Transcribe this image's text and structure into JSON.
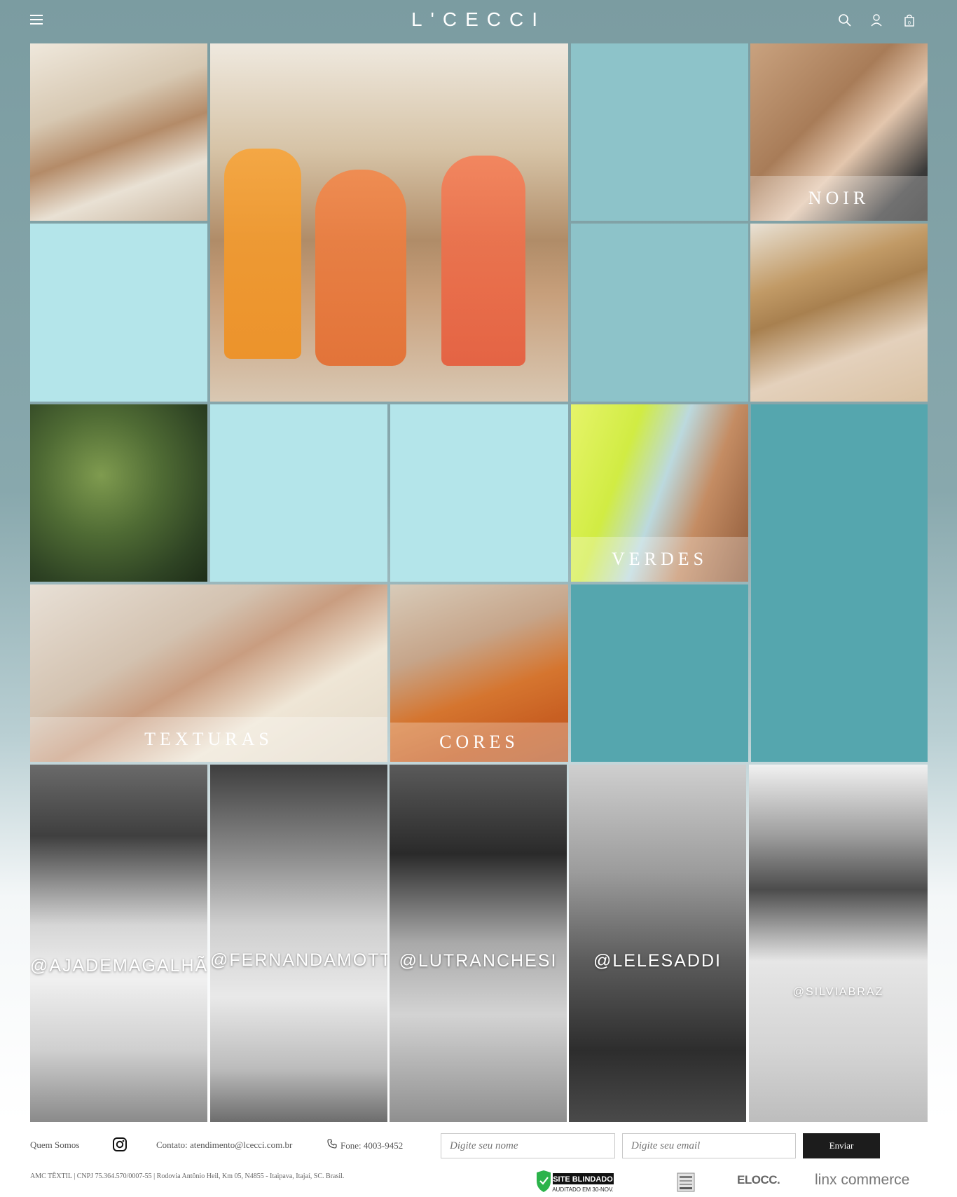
{
  "header": {
    "logo": "L'CECCI",
    "icons": [
      "menu-icon",
      "search-icon",
      "user-icon",
      "bag-icon"
    ],
    "bag_count": "0"
  },
  "grid": {
    "tiles": [
      {
        "caption": ""
      },
      {
        "caption": ""
      },
      {
        "caption": "NOIR"
      },
      {
        "caption": ""
      },
      {
        "caption": ""
      },
      {
        "caption": "VERDES"
      },
      {
        "caption": "TEXTURAS"
      },
      {
        "caption": "CORES"
      }
    ],
    "colors": {
      "light_blue": "#b4e5ea",
      "mid_blue": "#8dc3c9",
      "teal": "#55a6ae"
    }
  },
  "influencers": [
    {
      "handle": "@AJADEMAGALHÃES"
    },
    {
      "handle": "@FERNANDAMOTTA"
    },
    {
      "handle": "@LUTRANCHESI"
    },
    {
      "handle": "@LELESADDI"
    },
    {
      "handle": "@SILVIABRAZ"
    }
  ],
  "footer": {
    "about": "Quem Somos",
    "contact": "Contato: atendimento@lcecci.com.br",
    "phone": "Fone: 4003-9452",
    "name_placeholder": "Digite seu nome",
    "email_placeholder": "Digite seu email",
    "send": "Enviar",
    "legal": "AMC TÊXTIL | CNPJ 75.364.570/0007-55 | Rodovia Antônio Heil, Km 05, N4855 - Itaipava, Itajaí, SC. Brasil.",
    "badges": {
      "site_blindado": "SITE BLINDADO",
      "site_blindado_sub": "AUDITADO EM 30-NOV.",
      "eloca": "ELOCC.",
      "linx": "linx commerce"
    }
  }
}
